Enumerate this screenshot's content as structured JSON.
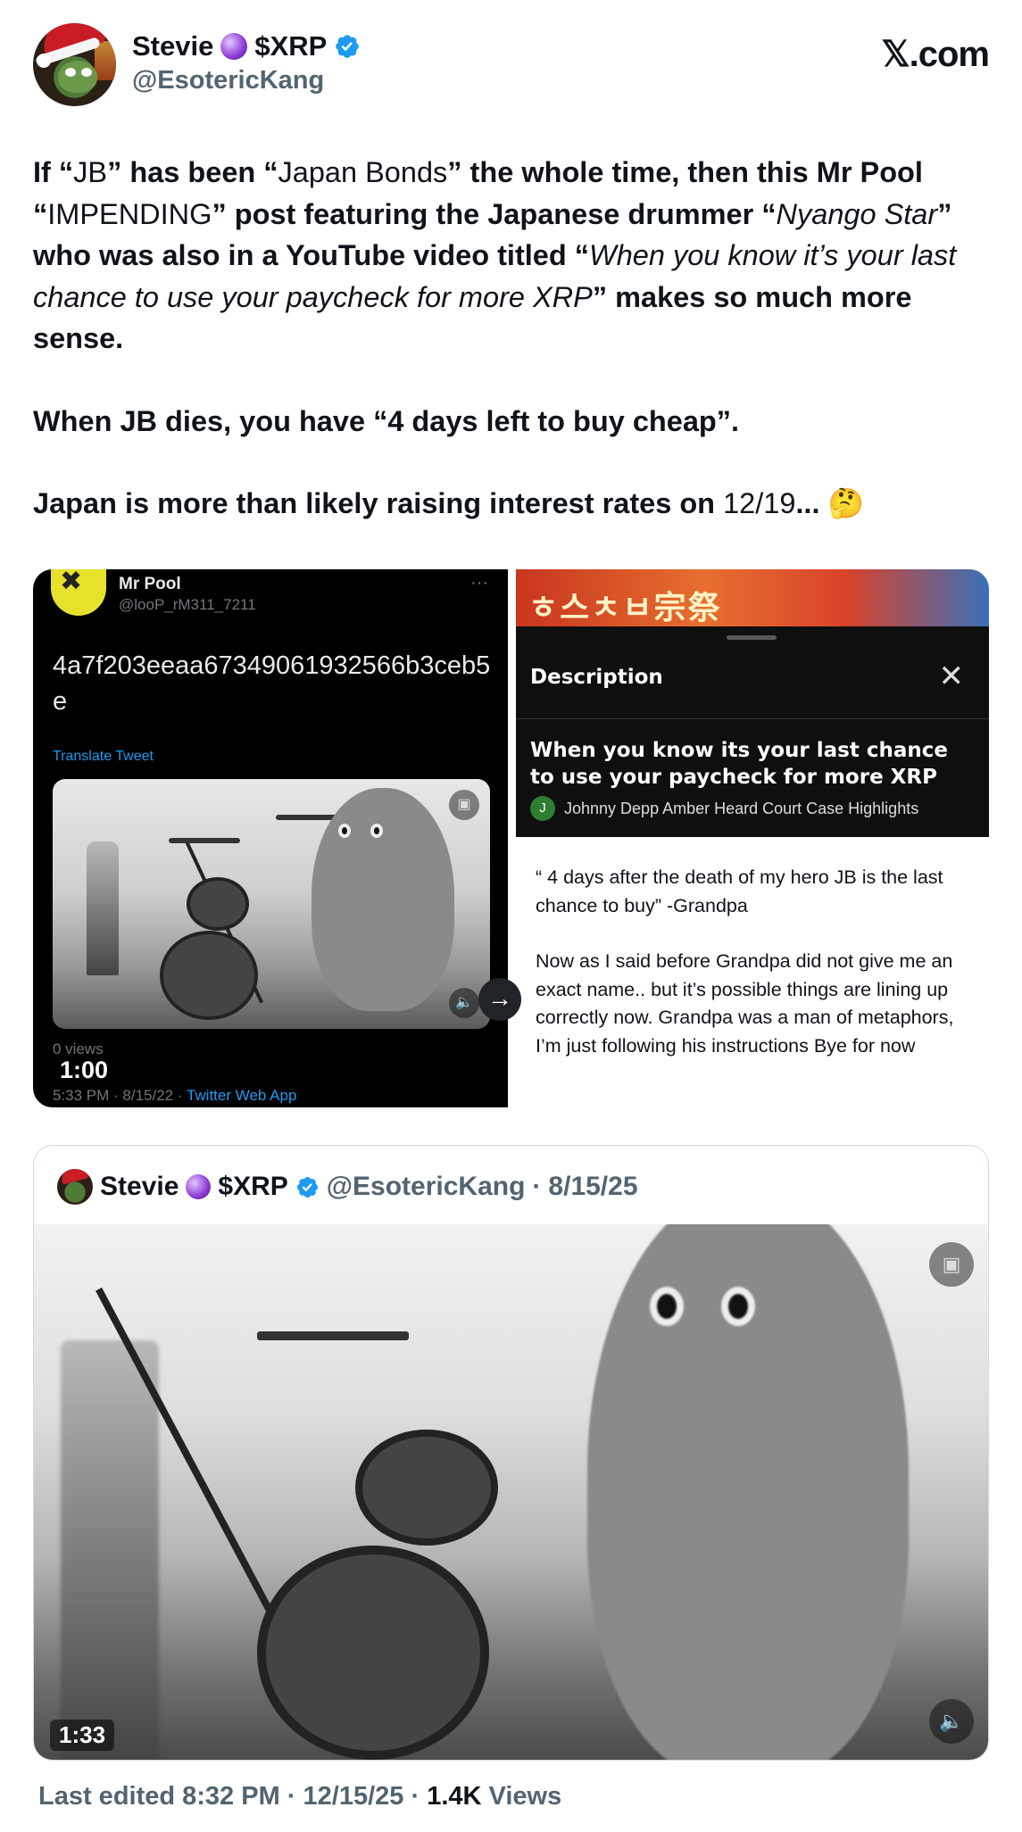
{
  "header": {
    "display_name": "Stevie",
    "ticker": "$XRP",
    "handle": "@EsotericKang",
    "site": "𝕏.com"
  },
  "tweet": {
    "p1": [
      {
        "t": "If “",
        "s": "b"
      },
      {
        "t": "JB",
        "s": "n"
      },
      {
        "t": "” has been “",
        "s": "b"
      },
      {
        "t": "Japan Bonds",
        "s": "n"
      },
      {
        "t": "” the whole time, then this Mr Pool “",
        "s": "b"
      },
      {
        "t": "IMPENDING",
        "s": "n"
      },
      {
        "t": "” post featuring the Japanese drummer “",
        "s": "b"
      },
      {
        "t": "Nyango Star",
        "s": "i"
      },
      {
        "t": "” who was also in a YouTube video titled “",
        "s": "b"
      },
      {
        "t": "When you know it’s your last chance to use your paycheck for more XRP",
        "s": "i"
      },
      {
        "t": "” makes so much more sense.",
        "s": "b"
      }
    ],
    "p2": "When JB dies, you have “4 days left to buy cheap”.",
    "p3_a": "Japan is more than likely raising interest rates on ",
    "p3_b": "12/19",
    "p3_c": "... 🤔"
  },
  "media_left": {
    "name": "Mr Pool",
    "handle": "@looP_rM311_7211",
    "more": "···",
    "hash": "4a7f203eeaa67349061932566b3ceb5e",
    "translate": "Translate Tweet",
    "views": "0 views",
    "duration": "1:00",
    "date": "5:33 PM · 8/15/22 · ",
    "app": "Twitter Web App"
  },
  "media_right": {
    "sign_text": "ㅎ스ㅊㅂ宗祭",
    "desc_title": "Description",
    "desc_body": "When you know its your last chance to use your paycheck for more XRP",
    "channel_initial": "J",
    "channel": "Johnny Depp Amber Heard Court Case Highlights",
    "note_p1": "“ 4 days after the death of my hero JB is the last chance to buy” -Grandpa",
    "note_p2": "Now as I said before Grandpa did not give me an exact name.. but it’s possible things are lining up correctly now. Grandpa was a man of metaphors, I’m just following his instructions Bye for now"
  },
  "quote": {
    "name": "Stevie",
    "ticker": "$XRP",
    "handle": "@EsotericKang",
    "sep": "·",
    "date": "8/15/25",
    "duration": "1:33"
  },
  "footer": {
    "edited": "Last edited 8:32 PM · 12/15/25 ·",
    "views_count": "1.4K",
    "views_label": "Views"
  },
  "colors": {
    "verified": "#1d9bf0",
    "link": "#1d9bf0",
    "secondary": "#536471"
  }
}
